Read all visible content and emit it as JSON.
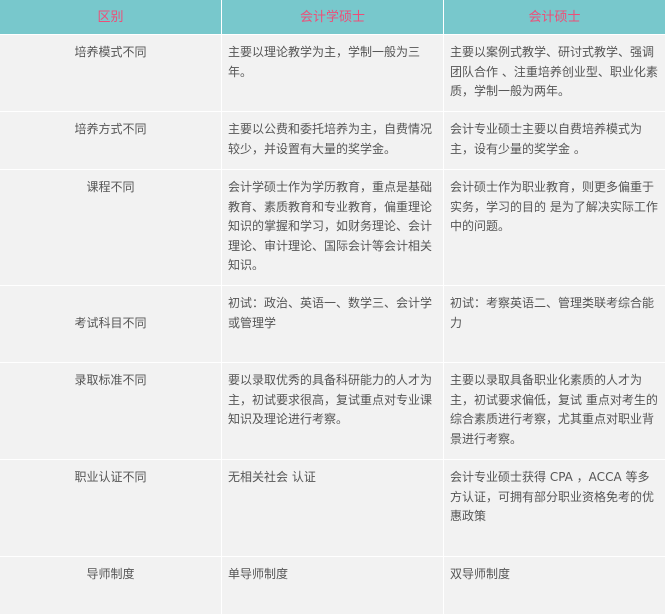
{
  "header": {
    "col1": "区别",
    "col2": "会计学硕士",
    "col3": "会计硕士"
  },
  "colors": {
    "header_bg": "#78c8cc",
    "header_text": "#ee4e78",
    "cell_bg": "#f2f2f2",
    "body_text": "#555555"
  },
  "rows": [
    {
      "aspect": "培养模式不同",
      "academic": "主要以理论教学为主，学制一般为三年。",
      "professional": "主要以案例式教学、研讨式教学、强调团队合作 、注重培养创业型、职业化素质，学制一般为两年。"
    },
    {
      "aspect": "培养方式不同",
      "academic": "主要以公费和委托培养为主，自费情况较少，并设置有大量的奖学金。",
      "professional": "会计专业硕士主要以自费培养模式为主，设有少量的奖学金 。"
    },
    {
      "aspect": "课程不同",
      "academic": "会计学硕士作为学历教育，重点是基础教育、素质教育和专业教育，偏重理论知识的掌握和学习，如财务理论、会计理论、审计理论、国际会计等会计相关知识。",
      "professional": "会计硕士作为职业教育，则更多偏重于实务，学习的目的 是为了解决实际工作中的问题。"
    },
    {
      "aspect": "考试科目不同",
      "academic": "初试：政治、英语一、数学三、会计学或管理学",
      "professional": "初试：考察英语二、管理类联考综合能力"
    },
    {
      "aspect": "录取标准不同",
      "academic": "要以录取优秀的具备科研能力的人才为主，初试要求很高，复试重点对专业课知识及理论进行考察。",
      "professional": "主要以录取具备职业化素质的人才为主，初试要求偏低，复试 重点对考生的综合素质进行考察，尤其重点对职业背景进行考察。"
    },
    {
      "aspect": "职业认证不同",
      "academic": "无相关社会 认证",
      "professional": "会计专业硕士获得 CPA ，ACCA 等多方认证，可拥有部分职业资格免考的优惠政策"
    },
    {
      "aspect": "导师制度",
      "academic": "单导师制度",
      "professional": "双导师制度"
    }
  ]
}
